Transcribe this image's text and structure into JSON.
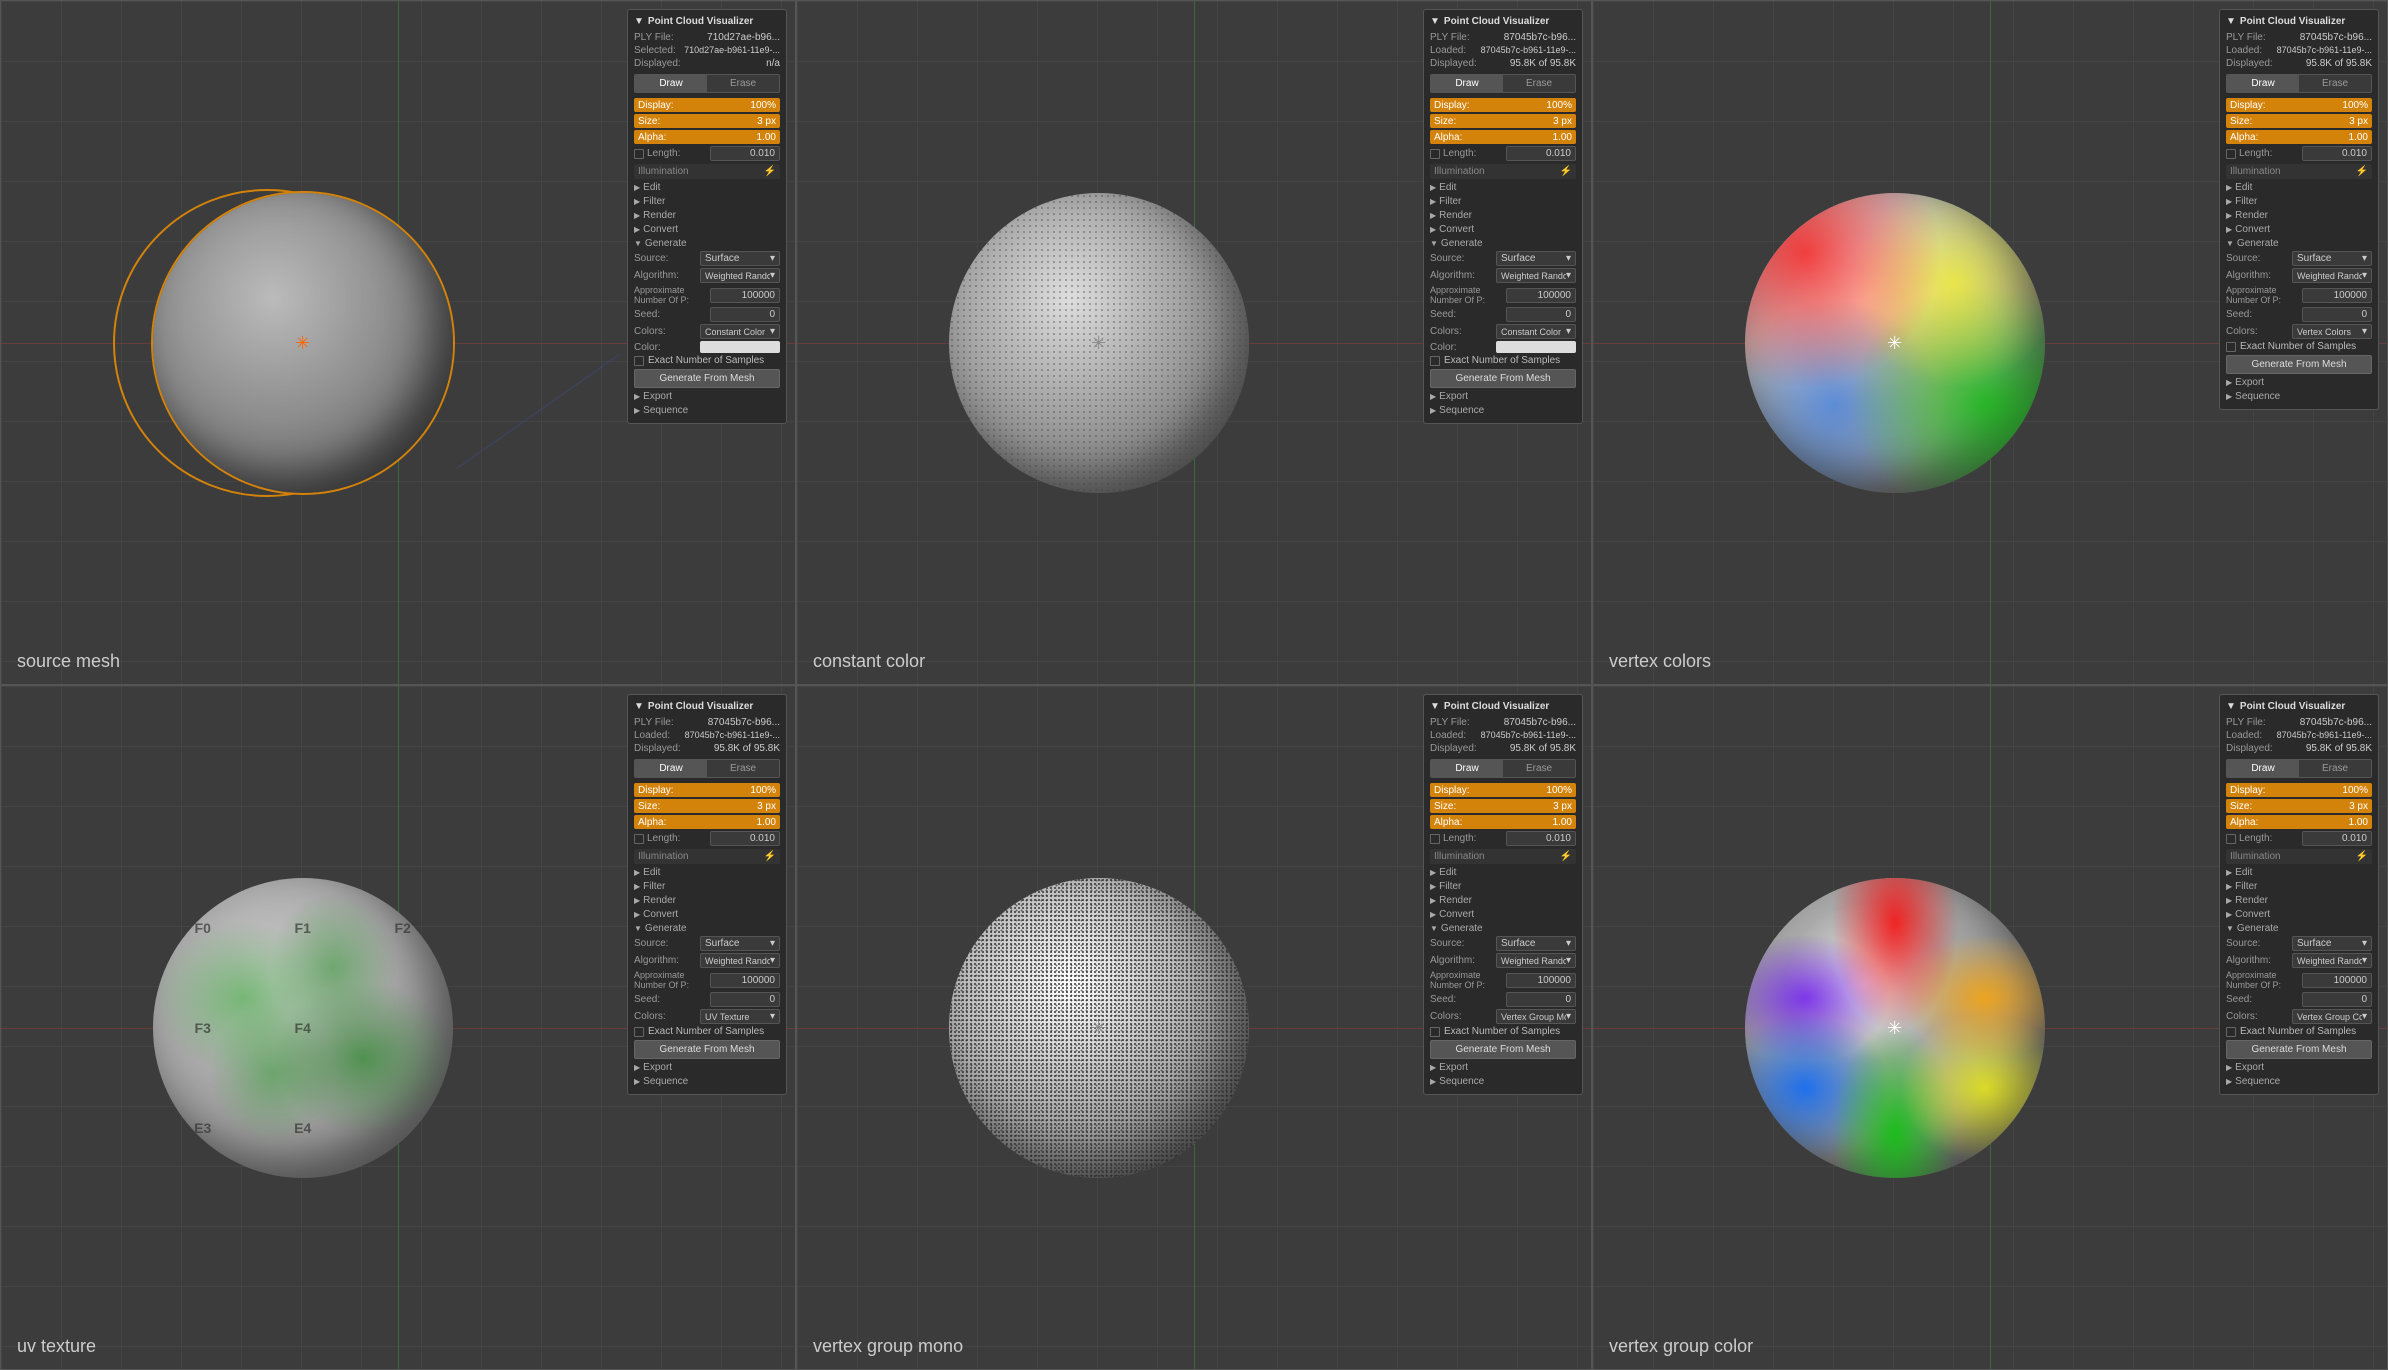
{
  "cells": [
    {
      "id": "source-mesh",
      "caption": "source mesh",
      "sphereType": "source",
      "panel": {
        "title": "Point Cloud Visualizer",
        "plyLabel": "PLY File:",
        "plyValue": "710d27ae-b96...",
        "selectedLabel": "Selected:",
        "selectedValue": "710d27ae-b961-11e9-...",
        "displayedLabel": "Displayed:",
        "displayedValue": "n/a",
        "tabs": [
          "Draw",
          "Erase"
        ],
        "activeTab": "Draw",
        "display": "100%",
        "size": "3 px",
        "alpha": "1.00",
        "length": "0.010",
        "sections": [
          "Edit",
          "Filter",
          "Render",
          "Convert",
          "Generate"
        ],
        "sourceLabel": "Source:",
        "sourceValue": "Surface",
        "algorithmLabel": "Algorithm:",
        "algorithmValue": "Weighted Random In ...",
        "approxLabel": "Approximate Number Of P:",
        "approxValue": "100000",
        "seedLabel": "Seed:",
        "seedValue": "0",
        "colorsLabel": "Colors:",
        "colorsValue": "Constant Color",
        "colorLabel": "Color:",
        "exactLabel": "Exact Number of Samples",
        "genButton": "Generate From Mesh",
        "exportSection": "Export",
        "sequenceSection": "Sequence"
      }
    },
    {
      "id": "constant-color",
      "caption": "constant color",
      "sphereType": "constant",
      "panel": {
        "title": "Point Cloud Visualizer",
        "plyLabel": "PLY File:",
        "plyValue": "87045b7c-b96...",
        "loadedLabel": "Loaded:",
        "loadedValue": "87045b7c-b961-11e9-...",
        "displayedLabel": "Displayed:",
        "displayedValue": "95.8K of 95.8K",
        "tabs": [
          "Draw",
          "Erase"
        ],
        "activeTab": "Draw",
        "display": "100%",
        "size": "3 px",
        "alpha": "1.00",
        "length": "0.010",
        "sections": [
          "Edit",
          "Filter",
          "Render",
          "Convert",
          "Generate"
        ],
        "sourceLabel": "Source:",
        "sourceValue": "Surface",
        "algorithmLabel": "Algorithm:",
        "algorithmValue": "Weighted Random In ...",
        "approxLabel": "Approximate Number Of P:",
        "approxValue": "100000",
        "seedLabel": "Seed:",
        "seedValue": "0",
        "colorsLabel": "Colors:",
        "colorsValue": "Constant Color",
        "colorLabel": "Color:",
        "exactLabel": "Exact Number of Samples",
        "genButton": "Generate From Mesh",
        "exportSection": "Export",
        "sequenceSection": "Sequence"
      }
    },
    {
      "id": "vertex-colors",
      "caption": "vertex colors",
      "sphereType": "vertex",
      "panel": {
        "title": "Point Cloud Visualizer",
        "plyLabel": "PLY File:",
        "plyValue": "87045b7c-b96...",
        "loadedLabel": "Loaded:",
        "loadedValue": "87045b7c-b961-11e9-...",
        "displayedLabel": "Displayed:",
        "displayedValue": "95.8K of 95.8K",
        "tabs": [
          "Draw",
          "Erase"
        ],
        "activeTab": "Draw",
        "display": "100%",
        "size": "3 px",
        "alpha": "1.00",
        "length": "0.010",
        "sections": [
          "Edit",
          "Filter",
          "Render",
          "Convert",
          "Generate"
        ],
        "sourceLabel": "Source:",
        "sourceValue": "Surface",
        "algorithmLabel": "Algorithm:",
        "algorithmValue": "Weighted Random In ...",
        "approxLabel": "Approximate Number Of P:",
        "approxValue": "100000",
        "seedLabel": "Seed:",
        "seedValue": "0",
        "colorsLabel": "Colors:",
        "colorsValue": "Vertex Colors",
        "exactLabel": "Exact Number of Samples",
        "genButton": "Generate From Mesh",
        "exportSection": "Export",
        "sequenceSection": "Sequence"
      }
    },
    {
      "id": "uv-texture",
      "caption": "uv texture",
      "sphereType": "uv",
      "panel": {
        "title": "Point Cloud Visualizer",
        "plyLabel": "PLY File:",
        "plyValue": "87045b7c-b96...",
        "loadedLabel": "Loaded:",
        "loadedValue": "87045b7c-b961-11e9-...",
        "displayedLabel": "Displayed:",
        "displayedValue": "95.8K of 95.8K",
        "tabs": [
          "Draw",
          "Erase"
        ],
        "activeTab": "Draw",
        "display": "100%",
        "size": "3 px",
        "alpha": "1.00",
        "length": "0.010",
        "sections": [
          "Edit",
          "Filter",
          "Render",
          "Convert",
          "Generate"
        ],
        "sourceLabel": "Source:",
        "sourceValue": "Surface",
        "algorithmLabel": "Algorithm:",
        "algorithmValue": "Weighted Random In ...",
        "approxLabel": "Approximate Number Of P:",
        "approxValue": "100000",
        "seedLabel": "Seed:",
        "seedValue": "0",
        "colorsLabel": "Colors:",
        "colorsValue": "UV Texture",
        "exactLabel": "Exact Number of Samples",
        "genButton": "Generate From Mesh",
        "exportSection": "Export",
        "sequenceSection": "Sequence"
      }
    },
    {
      "id": "vertex-group-mono",
      "caption": "vertex group mono",
      "sphereType": "vgmono",
      "panel": {
        "title": "Point Cloud Visualizer",
        "plyLabel": "PLY File:",
        "plyValue": "87045b7c-b96...",
        "loadedLabel": "Loaded:",
        "loadedValue": "87045b7c-b961-11e9-...",
        "displayedLabel": "Displayed:",
        "displayedValue": "95.8K of 95.8K",
        "tabs": [
          "Draw",
          "Erase"
        ],
        "activeTab": "Draw",
        "display": "100%",
        "size": "3 px",
        "alpha": "1.00",
        "length": "0.010",
        "sections": [
          "Edit",
          "Filter",
          "Render",
          "Convert",
          "Generate"
        ],
        "sourceLabel": "Source:",
        "sourceValue": "Surface",
        "algorithmLabel": "Algorithm:",
        "algorithmValue": "Weighted Random In ...",
        "approxLabel": "Approximate Number Of P:",
        "approxValue": "100000",
        "seedLabel": "Seed:",
        "seedValue": "0",
        "colorsLabel": "Colors:",
        "colorsValue": "Vertex Group Monoch...",
        "exactLabel": "Exact Number of Samples",
        "genButton": "Generate From Mesh",
        "exportSection": "Export",
        "sequenceSection": "Sequence"
      }
    },
    {
      "id": "vertex-group-color",
      "caption": "vertex group color",
      "sphereType": "vgcolor",
      "panel": {
        "title": "Point Cloud Visualizer",
        "plyLabel": "PLY File:",
        "plyValue": "87045b7c-b96...",
        "loadedLabel": "Loaded:",
        "loadedValue": "87045b7c-b961-11e9-...",
        "displayedLabel": "Displayed:",
        "displayedValue": "95.8K of 95.8K",
        "tabs": [
          "Draw",
          "Erase"
        ],
        "activeTab": "Draw",
        "display": "100%",
        "size": "3 px",
        "alpha": "1.00",
        "length": "0.010",
        "sections": [
          "Edit",
          "Filter",
          "Render",
          "Convert",
          "Generate"
        ],
        "sourceLabel": "Source:",
        "sourceValue": "Surface",
        "algorithmLabel": "Algorithm:",
        "algorithmValue": "Weighted Random In ...",
        "approxLabel": "Approximate Number Of P:",
        "approxValue": "100000",
        "seedLabel": "Seed:",
        "seedValue": "0",
        "colorsLabel": "Colors:",
        "colorsValue": "Vertex Group Colorized",
        "exactLabel": "Exact Number of Samples",
        "genButton": "Generate From Mesh",
        "exportSection": "Export",
        "sequenceSection": "Sequence"
      }
    }
  ]
}
